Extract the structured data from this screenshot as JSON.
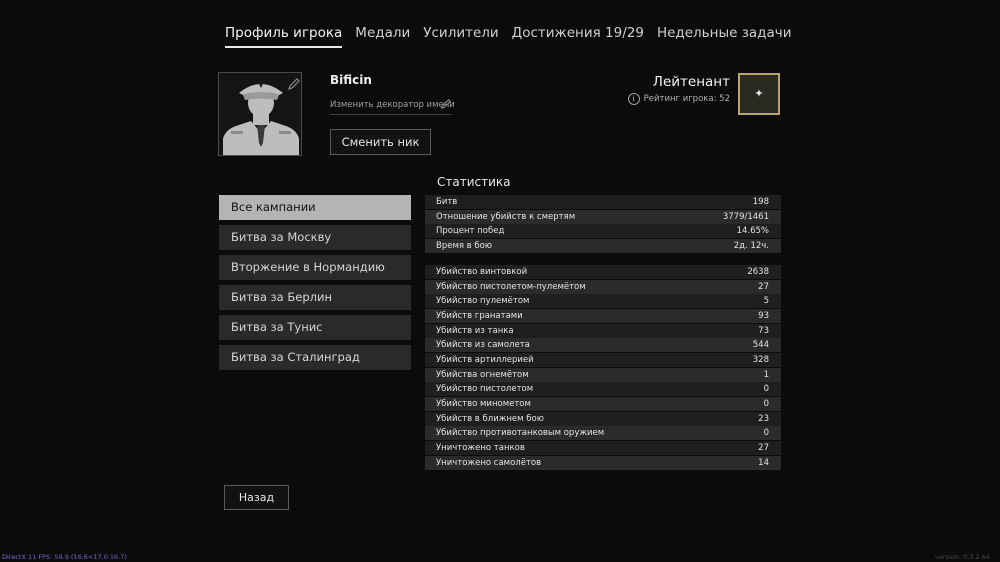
{
  "tabs": [
    {
      "label": "Профиль игрока",
      "active": true
    },
    {
      "label": "Медали",
      "active": false
    },
    {
      "label": "Усилители",
      "active": false
    },
    {
      "label": "Достижения 19/29",
      "active": false
    },
    {
      "label": "Недельные задачи",
      "active": false
    }
  ],
  "profile": {
    "nickname": "Bificin",
    "decorator_link": "Изменить декоратор имени",
    "change_nick_button": "Сменить ник",
    "avatar_icon": "soldier-portrait-icon",
    "edit_icon": "pencil-icon"
  },
  "rank": {
    "title": "Лейтенант",
    "rating_label": "Рейтинг игрока: 52",
    "info_icon": "info-icon",
    "badge_icon": "lieutenant-star-icon",
    "badge_symbol": "✦",
    "badge_border_color": "#b9a46a"
  },
  "campaigns": [
    {
      "label": "Все кампании",
      "active": true
    },
    {
      "label": "Битва за Москву",
      "active": false
    },
    {
      "label": "Вторжение в Нормандию",
      "active": false
    },
    {
      "label": "Битва за Берлин",
      "active": false
    },
    {
      "label": "Битва за Тунис",
      "active": false
    },
    {
      "label": "Битва за Сталинград",
      "active": false
    }
  ],
  "stats": {
    "title": "Статистика",
    "general": [
      {
        "label": "Битв",
        "value": "198"
      },
      {
        "label": "Отношение убийств к смертям",
        "value": "3779/1461"
      },
      {
        "label": "Процент побед",
        "value": "14.65%"
      },
      {
        "label": "Время в бою",
        "value": "2д. 12ч."
      }
    ],
    "kills": [
      {
        "label": "Убийство винтовкой",
        "value": "2638"
      },
      {
        "label": "Убийство пистолетом-пулемётом",
        "value": "27"
      },
      {
        "label": "Убийство пулемётом",
        "value": "5"
      },
      {
        "label": "Убийств гранатами",
        "value": "93"
      },
      {
        "label": "Убийств из танка",
        "value": "73"
      },
      {
        "label": "Убийств из самолета",
        "value": "544"
      },
      {
        "label": "Убийств артиллерией",
        "value": "328"
      },
      {
        "label": "Убийства огнемётом",
        "value": "1"
      },
      {
        "label": "Убийство пистолетом",
        "value": "0"
      },
      {
        "label": "Убийство минометом",
        "value": "0"
      },
      {
        "label": "Убийств в ближнем бою",
        "value": "23"
      },
      {
        "label": "Убийство противотанковым оружием",
        "value": "0"
      },
      {
        "label": "Уничтожено танков",
        "value": "27"
      },
      {
        "label": "Уничтожено самолётов",
        "value": "14"
      }
    ]
  },
  "back_button": "Назад",
  "footer": {
    "fps": "DirectX 11 FPS: 59.9 (16.6<17.0 16.7)",
    "version": "version: 0.3.2.64"
  }
}
